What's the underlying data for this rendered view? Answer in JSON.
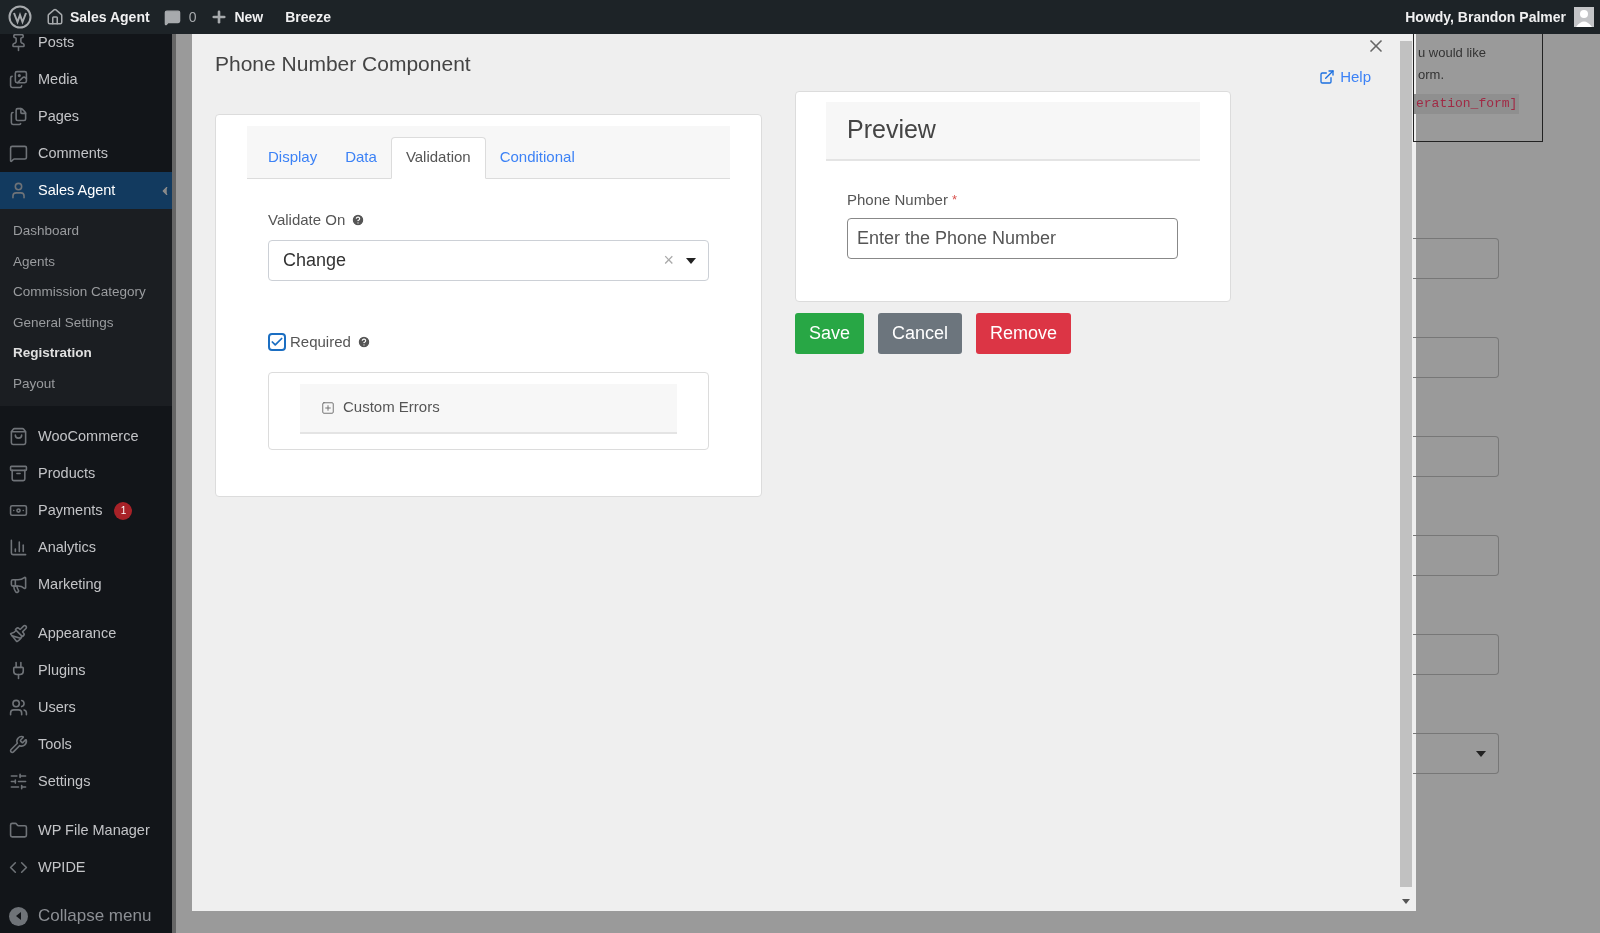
{
  "admin_bar": {
    "left": [
      {
        "kind": "logo"
      },
      {
        "kind": "home",
        "label": "Sales Agent"
      },
      {
        "kind": "comments",
        "label": "0"
      },
      {
        "kind": "new",
        "label": "New"
      },
      {
        "kind": "text",
        "label": "Breeze"
      }
    ],
    "greeting": "Howdy, Brandon Palmer"
  },
  "sidebar": {
    "groups": [
      {
        "items": [
          {
            "label": "Posts",
            "selected": false
          },
          {
            "label": "Media",
            "selected": false
          },
          {
            "label": "Pages",
            "selected": false
          },
          {
            "label": "Comments",
            "selected": false
          },
          {
            "label": "Sales Agent",
            "selected": true,
            "children": [
              {
                "label": "Dashboard",
                "selected": false
              },
              {
                "label": "Agents",
                "selected": false
              },
              {
                "label": "Commission Category",
                "selected": false
              },
              {
                "label": "General Settings",
                "selected": false
              },
              {
                "label": "Registration",
                "selected": true
              },
              {
                "label": "Payout",
                "selected": false
              }
            ]
          }
        ]
      },
      {
        "items": [
          {
            "label": "WooCommerce",
            "selected": false
          },
          {
            "label": "Products",
            "selected": false
          },
          {
            "label": "Payments",
            "selected": false,
            "badge": "1"
          },
          {
            "label": "Analytics",
            "selected": false
          },
          {
            "label": "Marketing",
            "selected": false
          }
        ]
      },
      {
        "items": [
          {
            "label": "Appearance",
            "selected": false
          },
          {
            "label": "Plugins",
            "selected": false
          },
          {
            "label": "Users",
            "selected": false
          },
          {
            "label": "Tools",
            "selected": false
          },
          {
            "label": "Settings",
            "selected": false
          }
        ]
      },
      {
        "items": [
          {
            "label": "WP File Manager",
            "selected": false
          },
          {
            "label": "WPIDE",
            "selected": false
          }
        ]
      }
    ],
    "collapse": "Collapse menu"
  },
  "background_page": {
    "lines": [
      "u would like",
      "orm."
    ],
    "code": "eration_form]",
    "fields": [
      {
        "kind": "input"
      },
      {
        "kind": "input"
      },
      {
        "kind": "input"
      },
      {
        "kind": "input"
      },
      {
        "kind": "input"
      },
      {
        "kind": "select"
      }
    ]
  },
  "modal": {
    "title": "Phone Number Component",
    "help": "Help",
    "tabs": [
      {
        "label": "Display",
        "selected": false
      },
      {
        "label": "Data",
        "selected": false
      },
      {
        "label": "Validation",
        "selected": true
      },
      {
        "label": "Conditional",
        "selected": false
      }
    ],
    "validate_on": {
      "label": "Validate On",
      "value": "Change",
      "clear": "×"
    },
    "required": {
      "label": "Required",
      "checked": true
    },
    "custom_errors": {
      "label": "Custom Errors",
      "expanded": false
    },
    "preview": {
      "title": "Preview",
      "field_label": "Phone Number",
      "required_mark": "*",
      "placeholder": "Enter the Phone Number"
    },
    "buttons": [
      {
        "label": "Save",
        "kind": "success"
      },
      {
        "label": "Cancel",
        "kind": "secondary"
      },
      {
        "label": "Remove",
        "kind": "danger"
      }
    ]
  }
}
